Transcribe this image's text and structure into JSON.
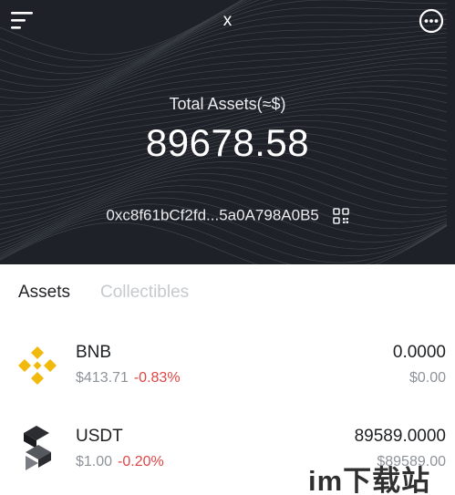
{
  "header": {
    "title": "x",
    "menu_icon": "menu-icon",
    "more_icon": "more-options-icon"
  },
  "summary": {
    "total_label": "Total Assets(≈$)",
    "total_value": "89678.58",
    "address": "0xc8f61bCf2fd...5a0A798A0B5",
    "qr_icon": "qr-code-icon"
  },
  "tabs": [
    {
      "label": "Assets",
      "active": true
    },
    {
      "label": "Collectibles",
      "active": false
    }
  ],
  "assets": [
    {
      "symbol": "BNB",
      "price": "$413.71",
      "change": "-0.83%",
      "balance": "0.0000",
      "fiat": "$0.00",
      "icon": "bnb-icon"
    },
    {
      "symbol": "USDT",
      "price": "$1.00",
      "change": "-0.20%",
      "balance": "89589.0000",
      "fiat": "$89589.00",
      "icon": "usdt-icon"
    }
  ],
  "watermark": "im下载站",
  "colors": {
    "header_bg": "#1e2228",
    "negative_change": "#e04545",
    "bnb_gold": "#f0b90b",
    "inactive_tab": "#c6c9ce"
  }
}
